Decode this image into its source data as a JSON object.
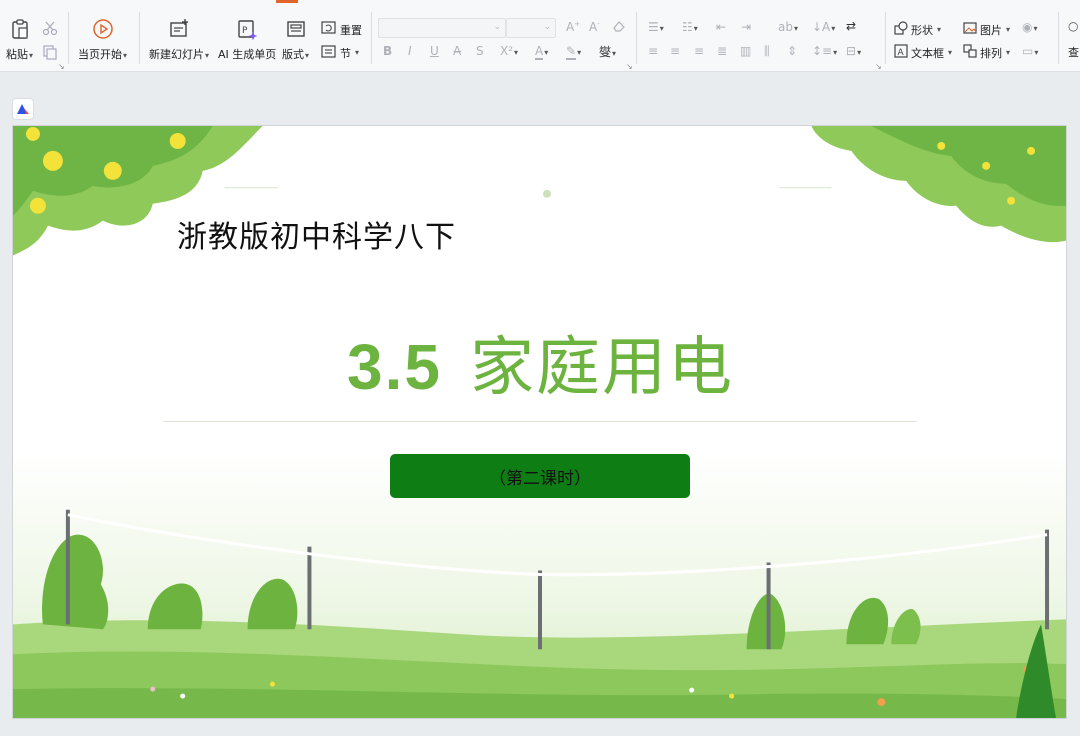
{
  "ribbon": {
    "paste": "粘贴",
    "from_current": "当页开始",
    "new_slide": "新建幻灯片",
    "ai_page": "AI 生成单页",
    "layout": "版式",
    "reset": "重置",
    "section": "节",
    "shape": "形状",
    "picture": "图片",
    "textbox": "文本框",
    "arrange": "排列",
    "find": "查"
  },
  "slide": {
    "top_subtitle": "浙教版初中科学八下",
    "title_number": "3.5",
    "title_text": "家庭用电",
    "lesson_pill": "（第二课时）"
  },
  "colors": {
    "title_green": "#6db33f",
    "pill_green": "#0e7d14",
    "accent_orange": "#e0652a"
  }
}
